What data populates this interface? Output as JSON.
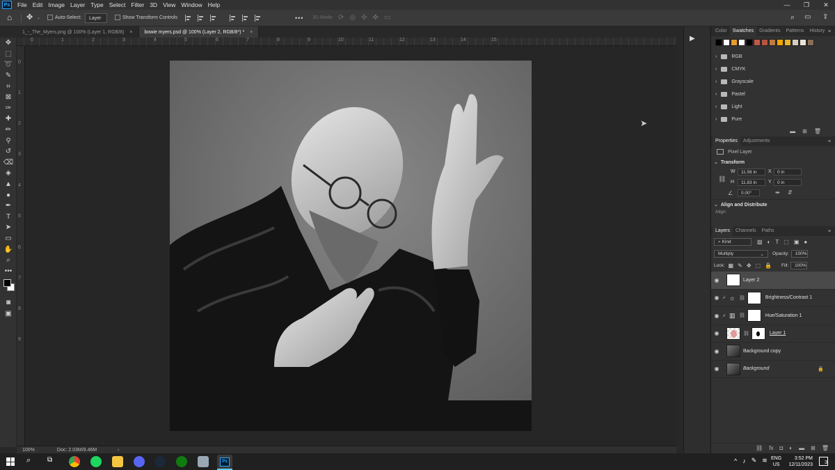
{
  "menubar": {
    "app_icon": "Ps",
    "items": [
      "File",
      "Edit",
      "Image",
      "Layer",
      "Type",
      "Select",
      "Filter",
      "3D",
      "View",
      "Window",
      "Help"
    ]
  },
  "options_bar": {
    "auto_select_label": "Auto-Select:",
    "auto_select_value": "Layer",
    "show_transform_label": "Show Transform Controls",
    "mode_3d_label": "3D Mode:",
    "more_label": "•••"
  },
  "tabs": [
    {
      "label": "1_-_The_Myers.png @ 100% (Layer 1, RGB/8)",
      "active": false
    },
    {
      "label": "bowie myers.psd @ 100% (Layer 2, RGB/8*) *",
      "active": true
    }
  ],
  "rulers": {
    "top": [
      "0",
      "1",
      "2",
      "3",
      "4",
      "5",
      "6",
      "7",
      "8",
      "9",
      "10",
      "11",
      "12",
      "13",
      "14",
      "15"
    ],
    "left": [
      "0",
      "1",
      "2",
      "3",
      "4",
      "5",
      "6",
      "7",
      "8",
      "9"
    ]
  },
  "status": {
    "zoom": "100%",
    "doc": "Doc: 2.03M/9.46M"
  },
  "swatches": {
    "tabs": [
      "Color",
      "Swatches",
      "Gradients",
      "Patterns",
      "History"
    ],
    "active_tab": "Swatches",
    "colors": [
      "#000000",
      "#ffffff",
      "#e89b2f",
      "#ffffff",
      "#000000",
      "#c0584a",
      "#b8543d",
      "#c17a3f",
      "#f3a600",
      "#e8b52d",
      "#d4cfc3",
      "#e9e4d8",
      "#8b6e55"
    ],
    "folders": [
      "RGB",
      "CMYK",
      "Grayscale",
      "Pastel",
      "Light",
      "Pure"
    ]
  },
  "properties": {
    "tabs": [
      "Properties",
      "Adjustments"
    ],
    "active_tab": "Properties",
    "type_label": "Pixel Layer",
    "transform_label": "Transform",
    "w_label": "W",
    "w_value": "11.56 in",
    "h_label": "H",
    "h_value": "11.83 in",
    "x_label": "X",
    "x_value": "0 in",
    "y_label": "Y",
    "y_value": "0 in",
    "angle_value": "0.00°",
    "align_label": "Align and Distribute",
    "align_sub": "Align:"
  },
  "layers": {
    "tabs": [
      "Layers",
      "Channels",
      "Paths"
    ],
    "active_tab": "Layers",
    "kind_label": "Kind",
    "blend_mode": "Multiply",
    "opacity_label": "Opacity:",
    "opacity_value": "100%",
    "lock_label": "Lock:",
    "fill_label": "Fill:",
    "fill_value": "100%",
    "items": [
      {
        "name": "Layer 2",
        "type": "pixel",
        "selected": true
      },
      {
        "name": "Brightness/Contrast 1",
        "type": "adjustment",
        "selected": false
      },
      {
        "name": "Hue/Saturation 1",
        "type": "adjustment",
        "selected": false
      },
      {
        "name": "Layer 1",
        "type": "pixel-masked",
        "selected": false
      },
      {
        "name": "Background copy",
        "type": "photo",
        "selected": false
      },
      {
        "name": "Background",
        "type": "photo-locked",
        "selected": false
      }
    ]
  },
  "taskbar": {
    "lang_top": "ENG",
    "lang_bottom": "US",
    "time": "3:52 PM",
    "date": "12/11/2023",
    "notification_count": "3"
  }
}
